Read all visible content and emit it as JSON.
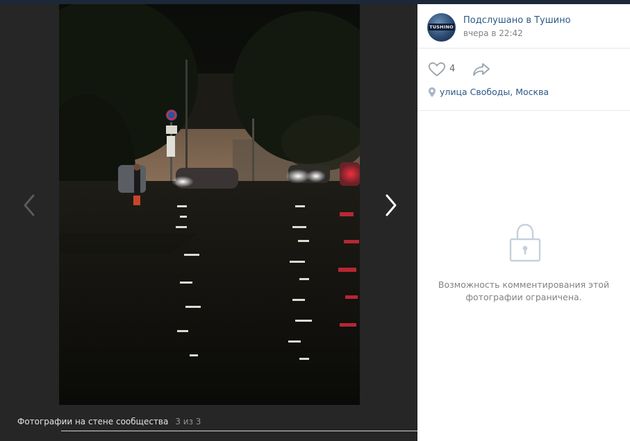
{
  "photo_viewer": {
    "caption": "Фотографии на стене сообщества",
    "counter": "3 из 3"
  },
  "post": {
    "author": "Подслушано в Тушино",
    "avatar_logo_text": "TUSHINO",
    "date": "вчера в 22:42",
    "likes": "4",
    "location": "улица Свободы, Москва"
  },
  "comments": {
    "restricted_text": "Возможность комментирования этой фотографии ограничена."
  },
  "icons": {
    "prev": "chevron-left-icon",
    "next": "chevron-right-icon",
    "like": "heart-icon",
    "share": "share-arrow-icon",
    "location": "map-pin-icon",
    "lock": "lock-icon"
  },
  "colors": {
    "link": "#2a5885",
    "muted": "#828282",
    "viewer_bg": "#262626"
  }
}
